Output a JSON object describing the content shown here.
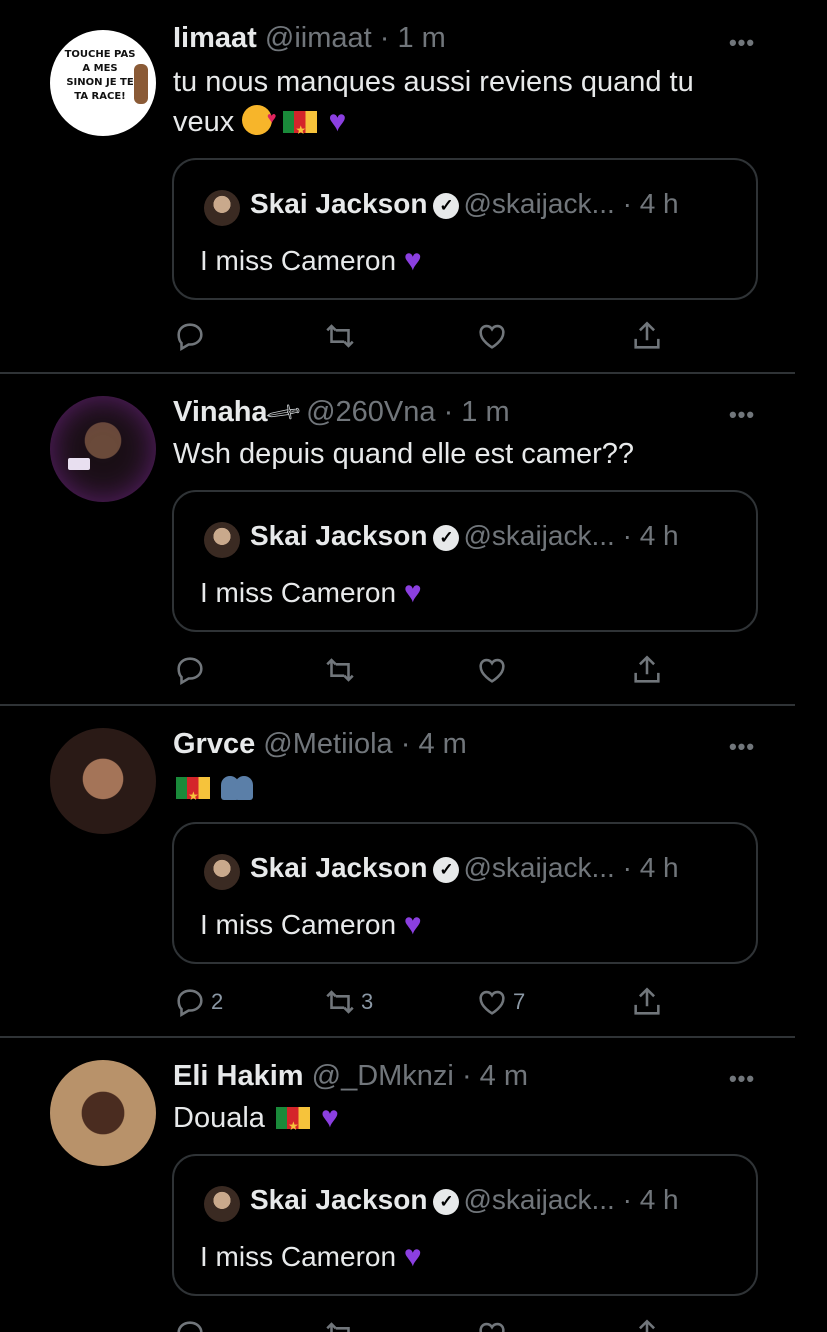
{
  "quoted_tweet": {
    "name": "Skai Jackson",
    "handle": "@skaijack...",
    "time": "· 4 h",
    "text": "I miss Cameron"
  },
  "tweets": [
    {
      "name": "Iimaat",
      "handle": "@iimaat",
      "time": "· 1 m",
      "text": "tu nous manques aussi reviens quand tu",
      "text2": "veux",
      "avatar_text": "TOUCHE PAS A MES SINON JE TE TA RACE!",
      "counts": {
        "reply": "",
        "retweet": "",
        "like": ""
      }
    },
    {
      "name": "Vinaha",
      "handle": "@260Vna",
      "time": "· 1 m",
      "text": "Wsh depuis quand elle est camer??",
      "counts": {
        "reply": "",
        "retweet": "",
        "like": ""
      }
    },
    {
      "name": "Grvce",
      "handle": "@Metiiola",
      "time": "· 4 m",
      "text": "",
      "counts": {
        "reply": "2",
        "retweet": "3",
        "like": "7"
      }
    },
    {
      "name": "Eli Hakim",
      "handle": "@_DMknzi",
      "time": "· 4 m",
      "text": "Douala",
      "counts": {
        "reply": "",
        "retweet": "",
        "like": ""
      }
    }
  ],
  "more_label": "•••",
  "colors": {
    "background": "#000000",
    "muted": "#71767b",
    "divider": "#2f3336",
    "purple_heart": "#8b3fe0"
  },
  "icons": [
    "reply-icon",
    "retweet-icon",
    "like-icon",
    "share-icon",
    "verified-icon",
    "more-icon"
  ]
}
